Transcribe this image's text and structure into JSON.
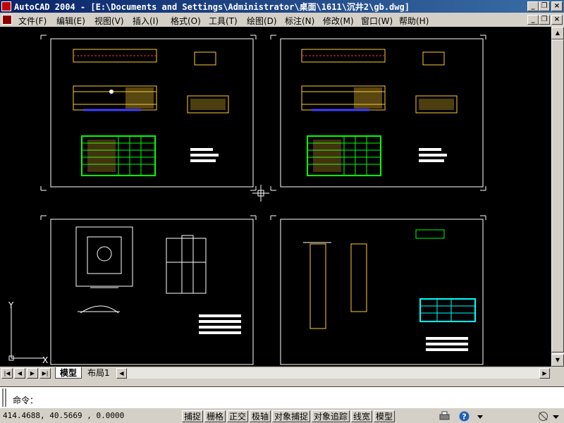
{
  "window": {
    "title": "AutoCAD 2004 - [E:\\Documents and Settings\\Administrator\\桌面\\1611\\沉井2\\gb.dwg]",
    "app_icon": "autocad-icon"
  },
  "menu": {
    "items": [
      "文件(F)",
      "编辑(E)",
      "视图(V)",
      "插入(I)",
      "格式(O)",
      "工具(T)",
      "绘图(D)",
      "标注(N)",
      "修改(M)",
      "窗口(W)",
      "帮助(H)"
    ]
  },
  "canvas": {
    "background": "#000000",
    "ucs": {
      "x_label": "X",
      "y_label": "Y"
    }
  },
  "layout_tabs": {
    "tabs": [
      "模型",
      "布局1"
    ],
    "active": "模型"
  },
  "command": {
    "prompt": "命令："
  },
  "status": {
    "coordinates": "414.4688, 40.5669  , 0.0000",
    "toggles": [
      "捕捉",
      "栅格",
      "正交",
      "极轴",
      "对象捕捉",
      "对象追踪",
      "线宽",
      "模型"
    ]
  },
  "colors": {
    "titlebar_start": "#0a246a",
    "titlebar_end": "#3a6ea5",
    "drawing_yellow": "#ffcc33",
    "drawing_green": "#00ff00",
    "drawing_cyan": "#00ffff",
    "drawing_red": "#ff0000",
    "drawing_blue": "#4040ff"
  }
}
